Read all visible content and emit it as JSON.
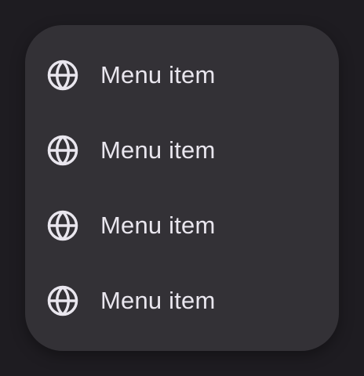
{
  "colors": {
    "background": "#1e1c21",
    "menu_surface": "#333136",
    "text": "#e9e6ee",
    "icon": "#e9e6ee"
  },
  "menu": {
    "items": [
      {
        "label": "Menu item",
        "icon": "globe-icon"
      },
      {
        "label": "Menu item",
        "icon": "globe-icon"
      },
      {
        "label": "Menu item",
        "icon": "globe-icon"
      },
      {
        "label": "Menu item",
        "icon": "globe-icon"
      }
    ]
  }
}
